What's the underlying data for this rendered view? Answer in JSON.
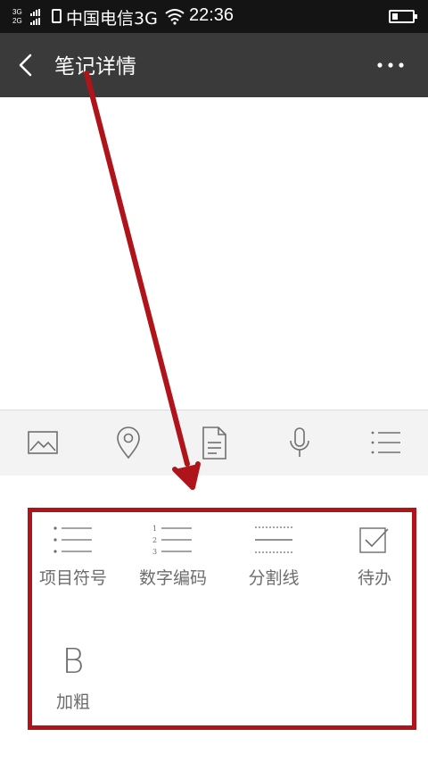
{
  "status_bar": {
    "network_top": "3G",
    "network_bottom": "2G",
    "carrier": "中国电信3G",
    "time": "22:36"
  },
  "nav": {
    "title": "笔记详情"
  },
  "toolbar": {
    "icons": [
      "image-icon",
      "location-icon",
      "document-icon",
      "microphone-icon",
      "list-icon"
    ]
  },
  "format_panel": {
    "items": [
      {
        "label": "项目符号",
        "icon": "bullet-list-icon"
      },
      {
        "label": "数字编码",
        "icon": "numbered-list-icon"
      },
      {
        "label": "分割线",
        "icon": "divider-icon"
      },
      {
        "label": "待办",
        "icon": "checkbox-icon"
      },
      {
        "label": "加粗",
        "icon": "bold-icon"
      }
    ],
    "number_marks": [
      "1",
      "2",
      "3"
    ],
    "bold_glyph": "B"
  },
  "colors": {
    "status_bar_bg": "#141414",
    "nav_bg": "#3a3a3a",
    "toolbar_bg": "#f3f3f3",
    "annotation_red": "#b0141b",
    "icon_gray": "#6d6d6d"
  }
}
